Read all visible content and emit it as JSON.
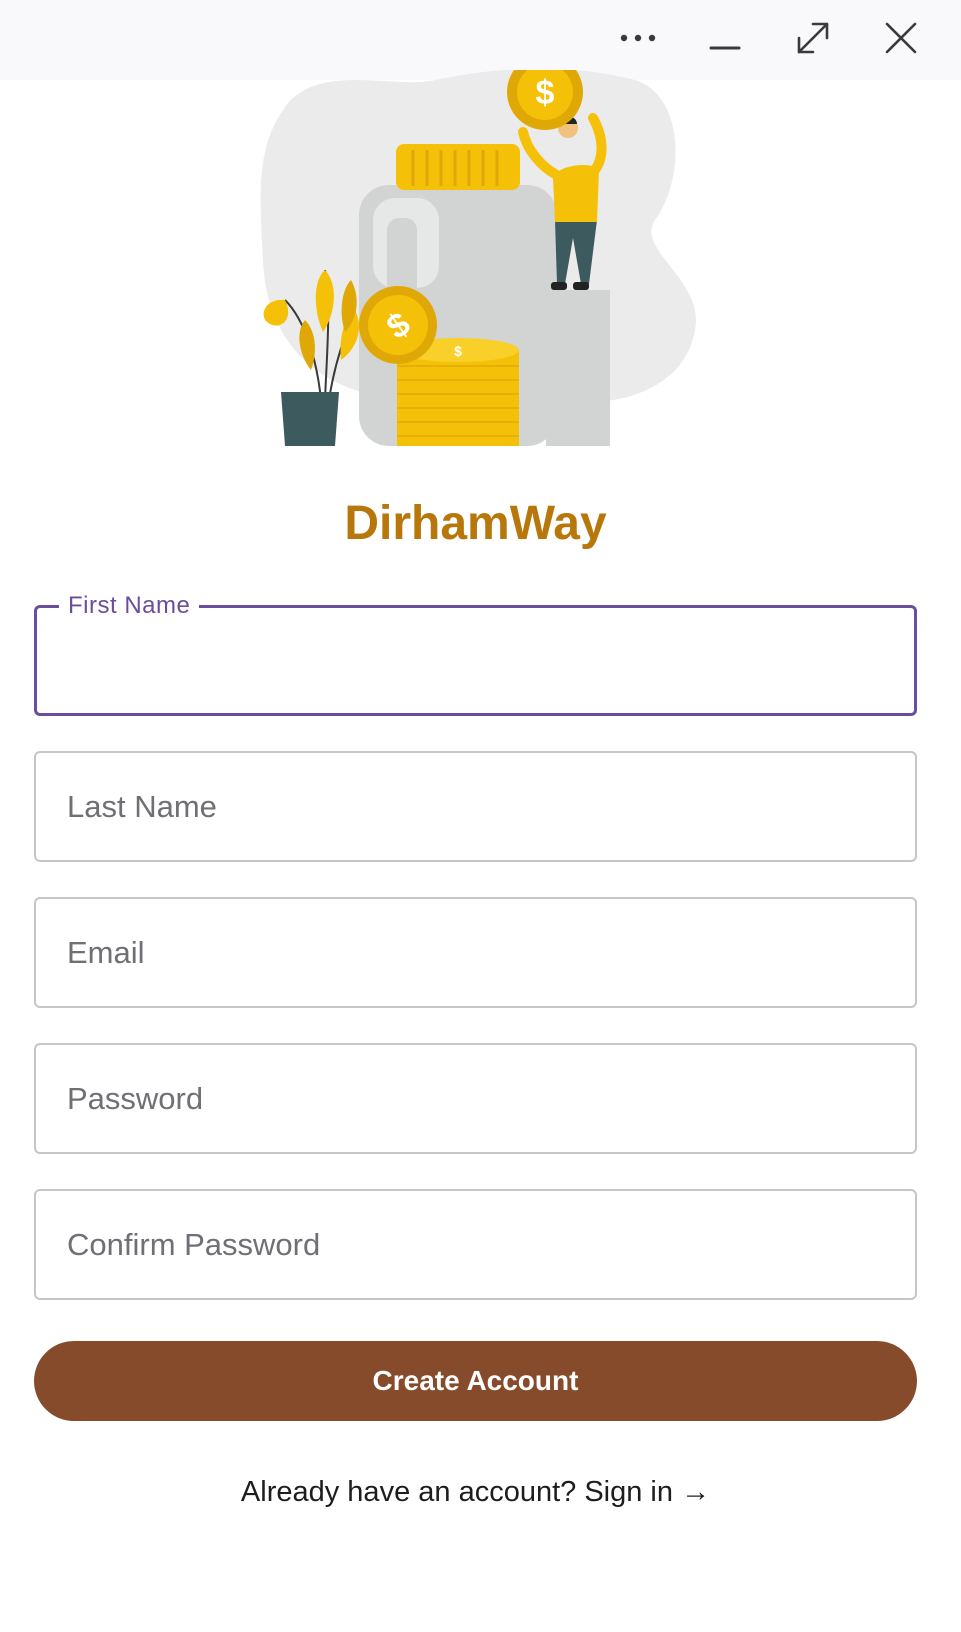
{
  "window_controls": {
    "more_icon": "more-horizontal-icon",
    "minimize_icon": "minimize-icon",
    "maximize_icon": "expand-icon",
    "close_icon": "close-icon"
  },
  "header": {
    "app_name": "DirhamWay"
  },
  "form": {
    "first_name": {
      "label": "First Name",
      "value": ""
    },
    "last_name": {
      "placeholder": "Last Name",
      "value": ""
    },
    "email": {
      "placeholder": "Email",
      "value": ""
    },
    "password": {
      "placeholder": "Password",
      "value": ""
    },
    "confirm_password": {
      "placeholder": "Confirm Password",
      "value": ""
    },
    "submit_label": "Create Account"
  },
  "footer": {
    "signin_prompt": "Already have an account? Sign in",
    "signin_arrow": "→"
  },
  "colors": {
    "brand_gold": "#b8770b",
    "button_brown": "#864b2b",
    "focus_purple": "#6b4d9b",
    "border_gray": "#c6c6ca",
    "titlebar_bg": "#f9f9fb"
  }
}
